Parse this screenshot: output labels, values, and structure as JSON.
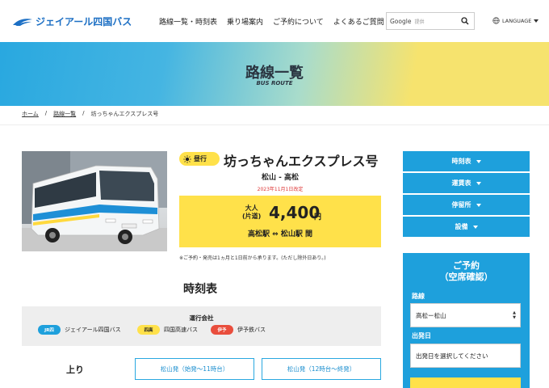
{
  "header": {
    "logo_text": "ジェイアール四国バス",
    "nav": [
      "路線一覧・時刻表",
      "乗り場案内",
      "ご予約について",
      "よくあるご質問"
    ],
    "search": {
      "brand": "Google",
      "placeholder": "提供"
    },
    "language": "LANGUAGE"
  },
  "hero": {
    "title": "路線一覧",
    "subtitle": "BUS ROUTE"
  },
  "breadcrumb": [
    "ホーム",
    "路線一覧",
    "坊っちゃんエクスプレス号"
  ],
  "route": {
    "badge": "昼行",
    "name": "坊っちゃんエクスプレス号",
    "area": "松山 - 高松",
    "revised": "2023年11月1日改定",
    "fare_label_1": "大人",
    "fare_label_2": "(片道)",
    "fare_amount": "4,400",
    "fare_unit": "円",
    "fare_stations": "高松駅 ⇔ 松山駅 間",
    "note": "※ご予約・発売は1ヵ月と1日前から承ります。(ただし除外日あり。)"
  },
  "timetable": {
    "title": "時刻表",
    "operators_title": "運行会社",
    "operators": [
      {
        "chip": "JR四",
        "name": "ジェイアール四国バス",
        "color": "#1ea0dc"
      },
      {
        "chip": "四高",
        "name": "四国高速バス",
        "color": "#ffe14a"
      },
      {
        "chip": "伊予",
        "name": "伊予鉄バス",
        "color": "#e94e3d"
      }
    ],
    "direction": "上り",
    "departures": [
      "松山発（始発〜11時台）",
      "松山発（12時台〜終発）"
    ]
  },
  "sidebar": {
    "buttons": [
      "時刻表",
      "運賃表",
      "停留所",
      "設備"
    ],
    "booking": {
      "title_1": "ご予約",
      "title_2": "（空席確認）",
      "route_label": "路線",
      "route_value": "高松ー松山",
      "date_label": "出発日",
      "date_placeholder": "出発日を選択してください"
    }
  },
  "colors": {
    "brand_blue": "#1ea0dc",
    "accent_yellow": "#ffe14a"
  }
}
